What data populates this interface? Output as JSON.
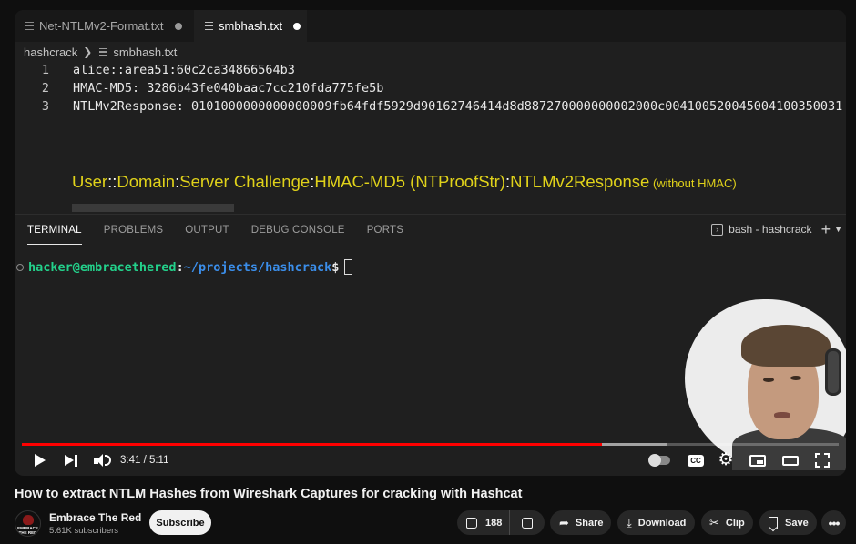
{
  "editor": {
    "tabs": [
      {
        "label": "Net-NTLMv2-Format.txt",
        "active": false
      },
      {
        "label": "smbhash.txt",
        "active": true
      }
    ],
    "breadcrumb": {
      "folder": "hashcrack",
      "file": "smbhash.txt"
    },
    "lines": [
      {
        "num": "1",
        "text": "alice::area51:60c2ca34866564b3"
      },
      {
        "num": "2",
        "text": "HMAC-MD5: 3286b43fe040baac7cc210fda775fe5b"
      },
      {
        "num": "3",
        "text": "NTLMv2Response: 0101000000000000009fb64fdf5929d90162746414d8d887270000000002000c004100520045004100350031"
      }
    ],
    "annotation": {
      "part1": "User",
      "sep1": "::",
      "part2": "Domain",
      "sep2": ":",
      "part3": "Server Challenge",
      "sep3": ":",
      "part4": "HMAC-MD5 (NTProofStr)",
      "sep4": ":",
      "part5": "NTLMv2Response",
      "note": " (without HMAC)"
    }
  },
  "panel": {
    "tabs": [
      "TERMINAL",
      "PROBLEMS",
      "OUTPUT",
      "DEBUG CONSOLE",
      "PORTS"
    ],
    "active_tab": "TERMINAL",
    "terminal_title": "bash - hashcrack",
    "prompt": {
      "user_host": "hacker@embracethered",
      "colon": ":",
      "path": "~/projects/hashcrack",
      "dollar": "$"
    }
  },
  "player": {
    "current_time": "3:41",
    "duration": "5:11",
    "time_display": "3:41 / 5:11",
    "progress_fraction": 0.7106,
    "loaded_fraction": 0.79,
    "progress_color": "#ff0000",
    "cc_label": "CC"
  },
  "video": {
    "title": "How to extract NTLM Hashes from Wireshark Captures for cracking with Hashcat"
  },
  "channel": {
    "name": "Embrace The Red",
    "subscribers": "5.61K subscribers",
    "subscribe_label": "Subscribe",
    "avatar_text": "EMBRACE THE RED"
  },
  "actions": {
    "likes": "188",
    "share_label": "Share",
    "download_label": "Download",
    "clip_label": "Clip",
    "save_label": "Save",
    "more_label": "•••"
  },
  "icons": [
    "file-icon",
    "breadcrumb-chevron-icon",
    "terminal-box-icon",
    "plus-icon",
    "chevron-down-icon",
    "play-icon",
    "next-icon",
    "volume-icon",
    "autoplay-toggle-icon",
    "cc-icon",
    "gear-icon",
    "miniplayer-icon",
    "theater-icon",
    "fullscreen-icon",
    "thumbs-up-icon",
    "thumbs-down-icon",
    "share-icon",
    "download-icon",
    "scissors-icon",
    "bookmark-icon",
    "more-icon"
  ]
}
